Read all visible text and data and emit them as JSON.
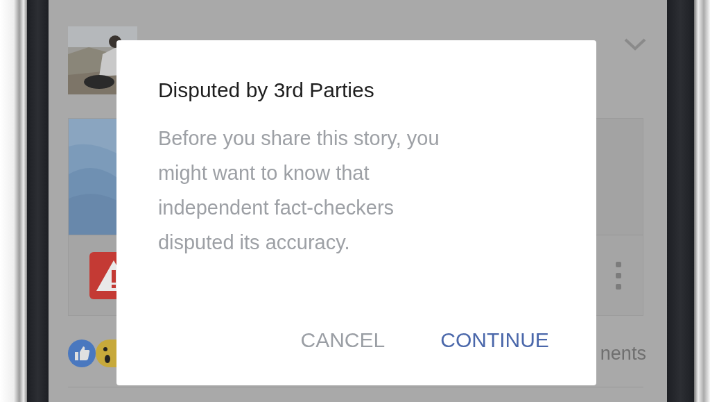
{
  "post": {
    "comments_partial": "nents"
  },
  "dialog": {
    "title": "Disputed by 3rd Parties",
    "message": "Before you share this story, you might want to know that independent fact-checkers disputed its accuracy.",
    "buttons": [
      {
        "label": "CANCEL",
        "kind": "secondary"
      },
      {
        "label": "CONTINUE",
        "kind": "primary"
      }
    ]
  }
}
